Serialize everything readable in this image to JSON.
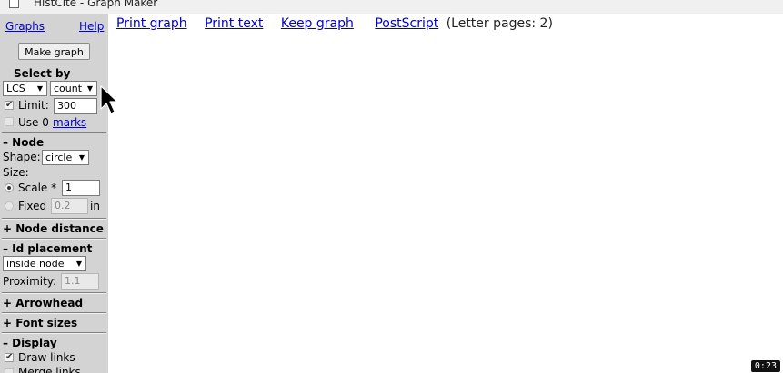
{
  "window": {
    "title": "HistCite - Graph Maker"
  },
  "sidebar": {
    "graphs_link": "Graphs",
    "help_link": "Help",
    "make_graph_button": "Make graph",
    "select_by": {
      "heading": "Select by",
      "primary_value": "LCS",
      "secondary_value": "count",
      "limit_label": "Limit:",
      "limit_value": "300",
      "limit_checked": true,
      "use0_label": "Use 0",
      "marks_link": "marks",
      "use0_checked": false
    },
    "node": {
      "heading": "– Node",
      "shape_label": "Shape:",
      "shape_value": "circle",
      "size_label": "Size:",
      "scale_label": "Scale *",
      "scale_value": "1",
      "scale_selected": true,
      "fixed_label": "Fixed",
      "fixed_value": "0.2",
      "fixed_unit": "in"
    },
    "node_distance": {
      "heading": "+ Node distance"
    },
    "id_placement": {
      "heading": "– Id placement",
      "placement_value": "inside node",
      "proximity_label": "Proximity:",
      "proximity_value": "1.1"
    },
    "arrowhead": {
      "heading": "+ Arrowhead"
    },
    "font_sizes": {
      "heading": "+ Font sizes"
    },
    "display": {
      "heading": "– Display",
      "draw_links_label": "Draw links",
      "draw_links_checked": true,
      "merge_links_label": "Merge links"
    }
  },
  "main": {
    "print_graph_link": "Print graph",
    "print_text_link": "Print text",
    "keep_graph_link": "Keep graph",
    "postscript_link": "PostScript",
    "pages_info": "(Letter pages: 2)"
  },
  "overlay": {
    "timer": "0:23"
  },
  "icons": {
    "caret": "▼",
    "check": "✔",
    "cursor": "arrow-cursor-icon"
  }
}
